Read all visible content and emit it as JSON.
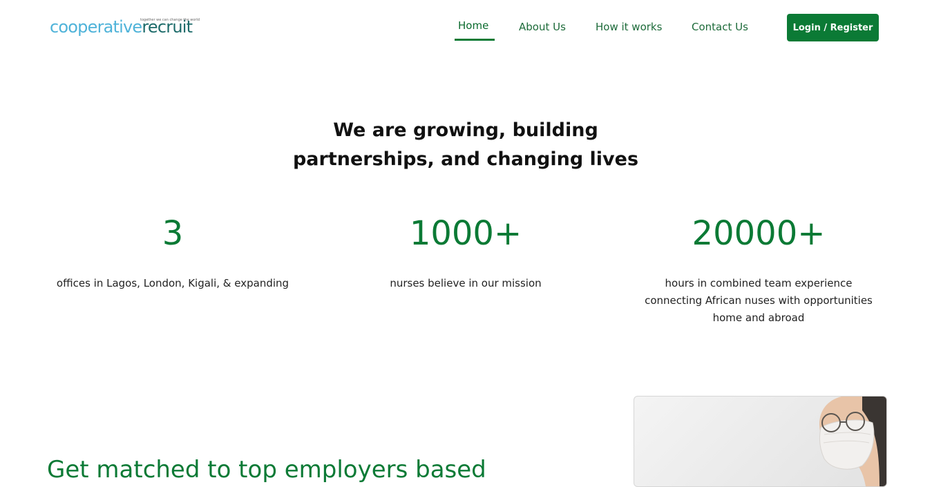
{
  "brand": {
    "name_part1": "cooperative",
    "name_part2": "recruit",
    "tagline": "together we can change the world"
  },
  "nav": {
    "items": [
      {
        "label": "Home",
        "active": true
      },
      {
        "label": "About Us",
        "active": false
      },
      {
        "label": "How it works",
        "active": false
      },
      {
        "label": "Contact Us",
        "active": false
      }
    ],
    "login_label": "Login / Register"
  },
  "hero": {
    "headline_line1": "We are growing, building",
    "headline_line2": "partnerships, and changing lives"
  },
  "stats": [
    {
      "value": "3",
      "text": "offices in Lagos, London, Kigali, & expanding"
    },
    {
      "value": "1000+",
      "text": "nurses believe in our mission"
    },
    {
      "value": "20000+",
      "text_lines": [
        "hours in combined team experience",
        "connecting African nuses with opportunities",
        "home and abroad"
      ]
    }
  ],
  "section2": {
    "title": "Get matched to top employers based"
  },
  "colors": {
    "primary_green": "#0b7a35",
    "logo_blue": "#4fb3d9",
    "logo_dark": "#1d6b6a"
  }
}
